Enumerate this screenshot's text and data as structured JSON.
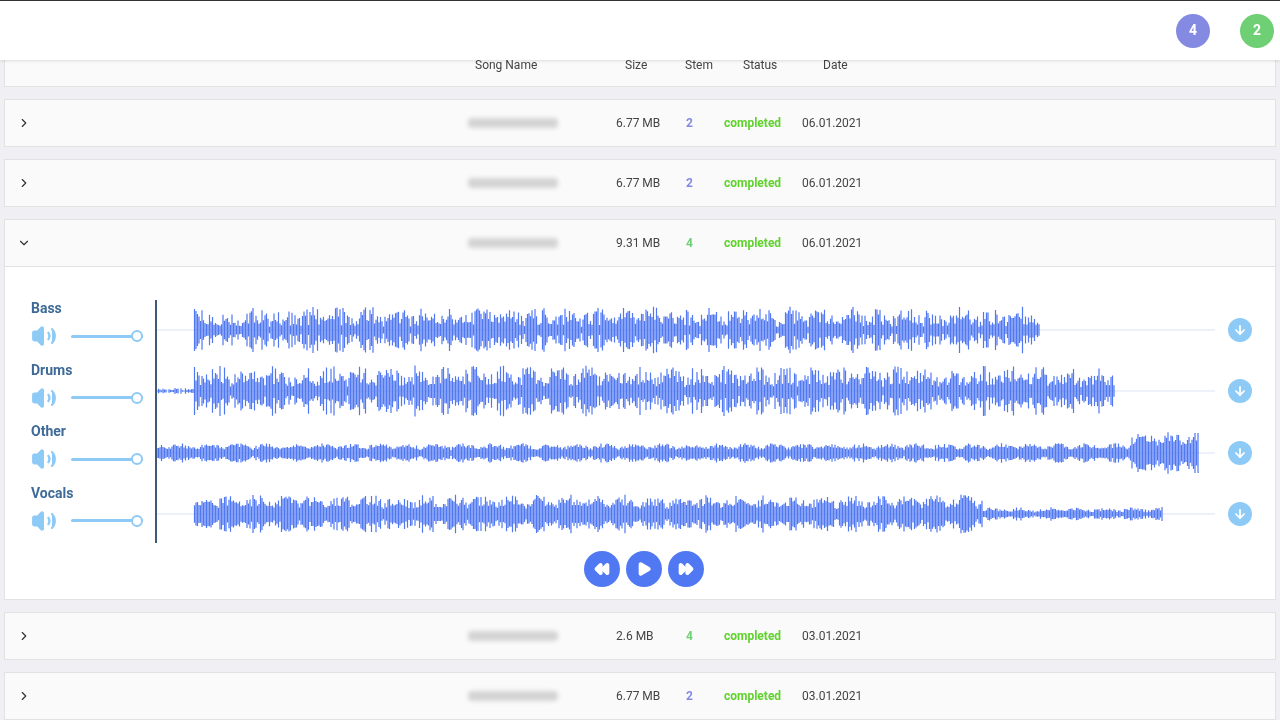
{
  "header": {
    "badges": [
      {
        "label": "4",
        "color": "#8489e1"
      },
      {
        "label": "2",
        "color": "#6fcf74"
      }
    ]
  },
  "columns": [
    "Song Name",
    "Size",
    "Stem",
    "Status",
    "Date"
  ],
  "rows": [
    {
      "expanded": false,
      "size": "6.77 MB",
      "stem": {
        "label": "2",
        "color": "#8489e1"
      },
      "status": "completed",
      "date": "06.01.2021"
    },
    {
      "expanded": false,
      "size": "6.77 MB",
      "stem": {
        "label": "2",
        "color": "#8489e1"
      },
      "status": "completed",
      "date": "06.01.2021"
    },
    {
      "expanded": true,
      "size": "9.31 MB",
      "stem": {
        "label": "4",
        "color": "#6fcf74"
      },
      "status": "completed",
      "date": "06.01.2021",
      "tracks": [
        {
          "name": "Bass",
          "level": 1
        },
        {
          "name": "Drums",
          "level": 1
        },
        {
          "name": "Other",
          "level": 1
        },
        {
          "name": "Vocals",
          "level": 1
        }
      ]
    },
    {
      "expanded": false,
      "size": "2.6 MB",
      "stem": {
        "label": "4",
        "color": "#6fcf74"
      },
      "status": "completed",
      "date": "03.01.2021"
    },
    {
      "expanded": false,
      "size": "6.77 MB",
      "stem": {
        "label": "2",
        "color": "#8489e1"
      },
      "status": "completed",
      "date": "03.01.2021"
    }
  ]
}
